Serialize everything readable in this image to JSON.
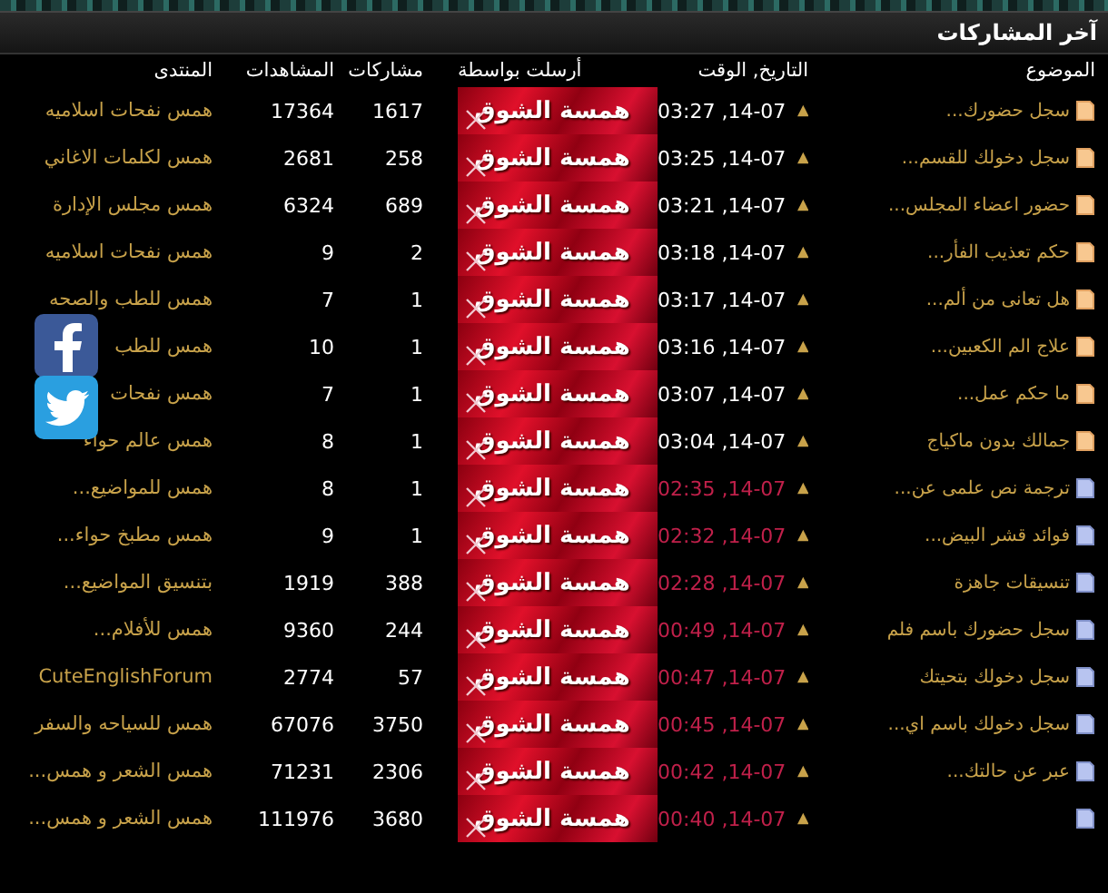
{
  "title": "آخر المشاركات",
  "columns": [
    "الموضوع",
    "التاريخ, الوقت",
    "أرسلت بواسطة",
    "مشاركات",
    "المشاهدات",
    "المنتدى"
  ],
  "rows": [
    {
      "topic": "سجل حضورك...",
      "hot": true,
      "time": "03:27 ,14-07",
      "poster": "همسة الشوق",
      "posts": "1617",
      "views": "17364",
      "forum": "همس نفحات اسلاميه"
    },
    {
      "topic": "سجل دخولك للقسم...",
      "hot": true,
      "time": "03:25 ,14-07",
      "poster": "همسة الشوق",
      "posts": "258",
      "views": "2681",
      "forum": "همس لكلمات الاغاني"
    },
    {
      "topic": "حضور اعضاء المجلس...",
      "hot": true,
      "time": "03:21 ,14-07",
      "poster": "همسة الشوق",
      "posts": "689",
      "views": "6324",
      "forum": "همس مجلس الإدارة"
    },
    {
      "topic": "حكم تعذيب الفأر...",
      "hot": true,
      "time": "03:18 ,14-07",
      "poster": "همسة الشوق",
      "posts": "2",
      "views": "9",
      "forum": "همس نفحات اسلاميه"
    },
    {
      "topic": "هل تعانى من ألم...",
      "hot": true,
      "time": "03:17 ,14-07",
      "poster": "همسة الشوق",
      "posts": "1",
      "views": "7",
      "forum": "همس للطب والصحه"
    },
    {
      "topic": "علاج الم الكعبين...",
      "hot": true,
      "time": "03:16 ,14-07",
      "poster": "همسة الشوق",
      "posts": "1",
      "views": "10",
      "forum": "همس للطب"
    },
    {
      "topic": "ما حكم عمل...",
      "hot": true,
      "time": "03:07 ,14-07",
      "poster": "همسة الشوق",
      "posts": "1",
      "views": "7",
      "forum": "همس نفحات"
    },
    {
      "topic": "جمالك بدون ماكياج",
      "hot": true,
      "time": "03:04 ,14-07",
      "poster": "همسة الشوق",
      "posts": "1",
      "views": "8",
      "forum": "همس عالم حواء"
    },
    {
      "topic": "ترجمة نص علمى عن...",
      "hot": false,
      "time": "02:35 ,14-07",
      "poster": "همسة الشوق",
      "posts": "1",
      "views": "8",
      "forum": "همس للمواضيع..."
    },
    {
      "topic": "فوائد قشر البيض...",
      "hot": false,
      "time": "02:32 ,14-07",
      "poster": "همسة الشوق",
      "posts": "1",
      "views": "9",
      "forum": "همس مطبخ حواء..."
    },
    {
      "topic": "تنسيقات جاهزة",
      "hot": false,
      "time": "02:28 ,14-07",
      "poster": "همسة الشوق",
      "posts": "388",
      "views": "1919",
      "forum": "بتنسيق المواضيع..."
    },
    {
      "topic": "سجل حضورك باسم فلم",
      "hot": false,
      "time": "00:49 ,14-07",
      "poster": "همسة الشوق",
      "posts": "244",
      "views": "9360",
      "forum": "همس للأفلام..."
    },
    {
      "topic": "سجل دخولك بتحيتك",
      "hot": false,
      "time": "00:47 ,14-07",
      "poster": "همسة الشوق",
      "posts": "57",
      "views": "2774",
      "forum": "CuteEnglishForum"
    },
    {
      "topic": "سجل دخولك باسم اي...",
      "hot": false,
      "time": "00:45 ,14-07",
      "poster": "همسة الشوق",
      "posts": "3750",
      "views": "67076",
      "forum": "همس للسياحه والسفر"
    },
    {
      "topic": "عبر عن حالتك...",
      "hot": false,
      "time": "00:42 ,14-07",
      "poster": "همسة الشوق",
      "posts": "2306",
      "views": "71231",
      "forum": "همس الشعر و همس..."
    },
    {
      "hot": false,
      "time": "00:40 ,14-07",
      "poster": "همسة الشوق",
      "posts": "3680",
      "views": "111976",
      "forum": "همس الشعر و همس..."
    }
  ]
}
